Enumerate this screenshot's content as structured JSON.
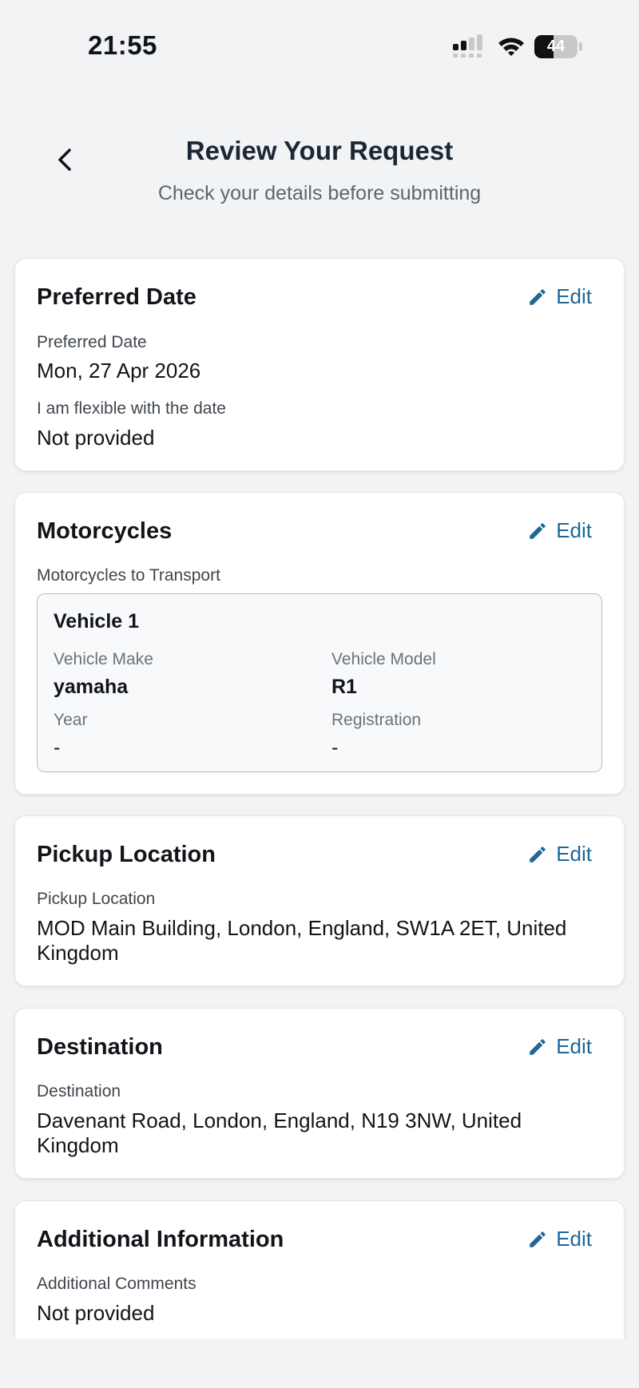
{
  "status_bar": {
    "time": "21:55",
    "battery": "44",
    "battery_level": 0.44
  },
  "header": {
    "title": "Review Your Request",
    "subtitle": "Check your details before submitting"
  },
  "cards": {
    "preferred_date": {
      "title": "Preferred Date",
      "edit_label": "Edit",
      "fields": [
        {
          "label": "Preferred Date",
          "value": "Mon, 27 Apr 2026"
        },
        {
          "label": "I am flexible with the date",
          "value": "Not provided"
        }
      ]
    },
    "motorcycles": {
      "title": "Motorcycles",
      "edit_label": "Edit",
      "section_label": "Motorcycles to Transport",
      "vehicle": {
        "title": "Vehicle 1",
        "make_label": "Vehicle Make",
        "make": "yamaha",
        "model_label": "Vehicle Model",
        "model": "R1",
        "year_label": "Year",
        "year": "-",
        "registration_label": "Registration",
        "registration": "-"
      }
    },
    "pickup": {
      "title": "Pickup Location",
      "edit_label": "Edit",
      "label": "Pickup Location",
      "value_line1": "MOD Main Building, London, England, SW1A 2ET, United",
      "value_line2": "Kingdom"
    },
    "destination": {
      "title": "Destination",
      "edit_label": "Edit",
      "label": "Destination",
      "value_line1": "Davenant Road, London, England, N19 3NW, United",
      "value_line2": "Kingdom"
    },
    "additional": {
      "title": "Additional Information",
      "edit_label": "Edit",
      "label": "Additional Comments",
      "value": "Not provided"
    }
  },
  "colors": {
    "accent": "#1e6796",
    "background": "#f2f3f5",
    "card": "#ffffff"
  }
}
